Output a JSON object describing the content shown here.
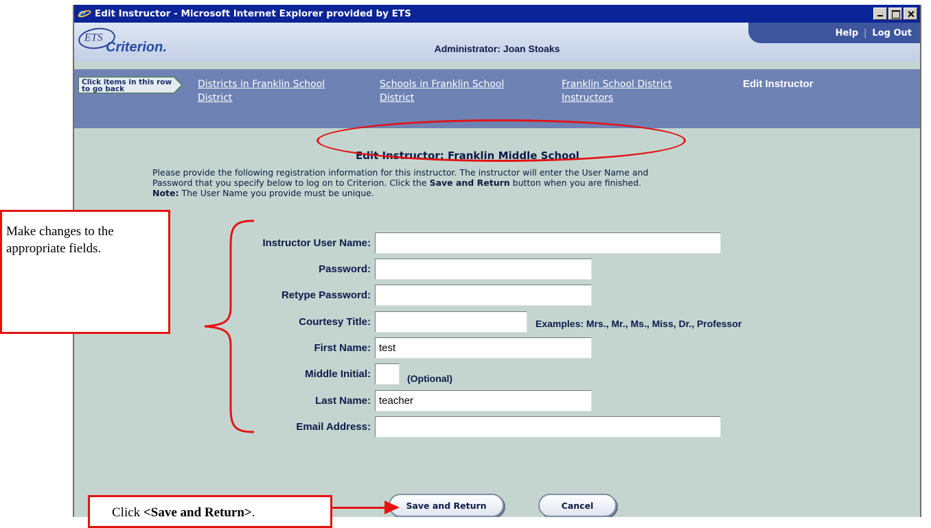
{
  "window": {
    "title": "Edit Instructor - Microsoft Internet Explorer provided by ETS",
    "controls": [
      "minimize",
      "maximize",
      "close"
    ]
  },
  "header": {
    "logo_text": "ETS",
    "brand": "Criterion.",
    "admin_label": "Administrator: Joan Stoaks",
    "help_label": "Help",
    "separator": "|",
    "logout_label": "Log Out"
  },
  "breadcrumb": {
    "hint": "Click items in this row to go back",
    "items": [
      {
        "line1": "Districts in Franklin School",
        "line2": "District"
      },
      {
        "line1": "Schools in Franklin School",
        "line2": "District"
      },
      {
        "line1": "Franklin School District",
        "line2": "Instructors"
      }
    ],
    "current": "Edit Instructor"
  },
  "page": {
    "title": "Edit Instructor:  Franklin Middle School",
    "intro_line1": "Please provide the following registration information for this instructor. The instructor will enter the User Name and",
    "intro_line2a": "Password that you specify below to log on to Criterion. Click the ",
    "intro_line2b": "Save and Return",
    "intro_line2c": " button when you are finished.",
    "note_label": "Note:",
    "note_text": " The User Name you provide must be unique."
  },
  "form": {
    "user_name": {
      "label": "Instructor User Name:",
      "value": ""
    },
    "password": {
      "label": "Password:",
      "value": ""
    },
    "retype_password": {
      "label": "Retype Password:",
      "value": ""
    },
    "courtesy_title": {
      "label": "Courtesy Title:",
      "value": "",
      "hint": "Examples: Mrs., Mr., Ms., Miss, Dr., Professor"
    },
    "first_name": {
      "label": "First Name:",
      "value": "test"
    },
    "middle_initial": {
      "label": "Middle Initial:",
      "value": "",
      "hint": "(Optional)"
    },
    "last_name": {
      "label": "Last Name:",
      "value": "teacher"
    },
    "email": {
      "label": "Email Address:",
      "value": ""
    }
  },
  "buttons": {
    "save": "Save and Return",
    "cancel": "Cancel"
  },
  "annotations": {
    "changes_line1": "Make changes to the",
    "changes_line2": "appropriate fields.",
    "click_prefix": "Click ",
    "click_bold": "<Save and Return>",
    "click_suffix": ".",
    "accent_color": "#e31313"
  }
}
